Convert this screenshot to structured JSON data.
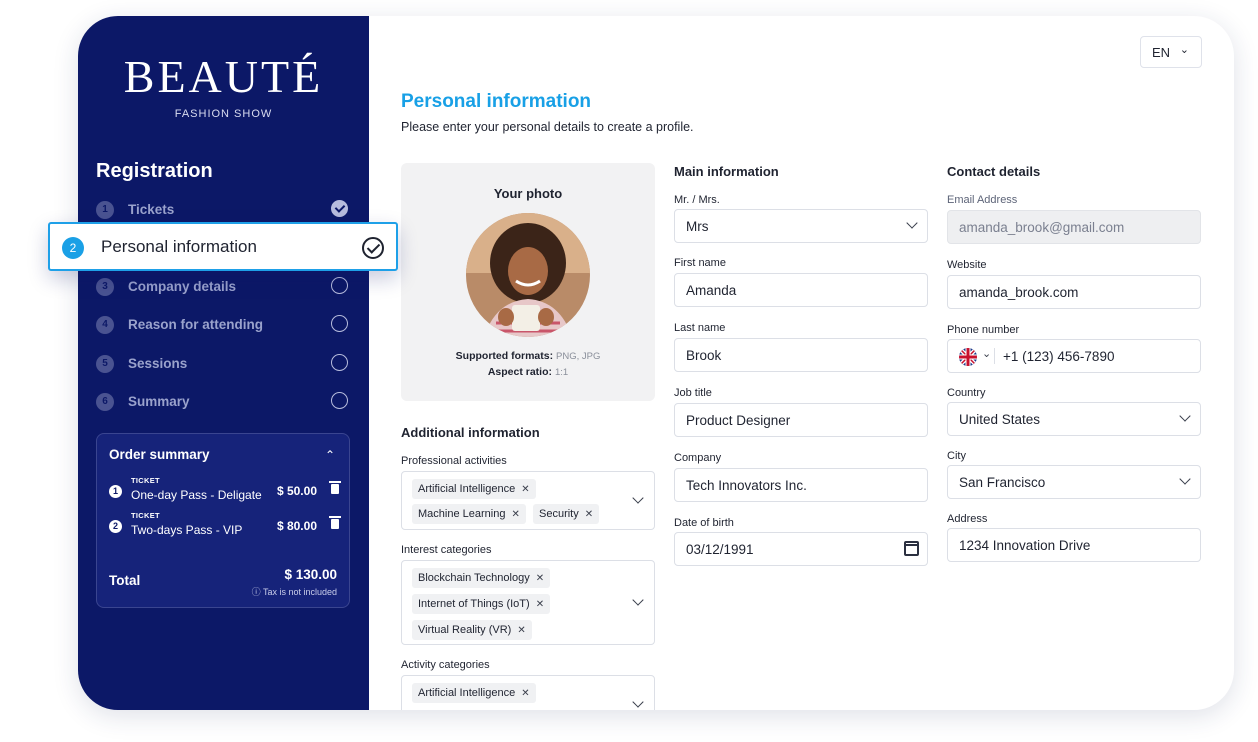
{
  "brand": {
    "name": "BEAUTÉ",
    "subtitle": "FASHION SHOW"
  },
  "sidebar": {
    "title": "Registration",
    "steps": [
      {
        "num": "1",
        "label": "Tickets",
        "status": "done"
      },
      {
        "num": "2",
        "label": "Personal information",
        "status": "active"
      },
      {
        "num": "3",
        "label": "Company details",
        "status": "todo"
      },
      {
        "num": "4",
        "label": "Reason for attending",
        "status": "todo"
      },
      {
        "num": "5",
        "label": "Sessions",
        "status": "todo"
      },
      {
        "num": "6",
        "label": "Summary",
        "status": "todo"
      }
    ]
  },
  "order": {
    "title": "Order summary",
    "items": [
      {
        "num": "1",
        "tag": "TICKET",
        "name": "One-day Pass - Deligate",
        "price": "$ 50.00"
      },
      {
        "num": "2",
        "tag": "TICKET",
        "name": "Two-days Pass - VIP",
        "price": "$ 80.00"
      }
    ],
    "total_label": "Total",
    "total_value": "$ 130.00",
    "tax_note": "ⓘ Tax is not included"
  },
  "lang": {
    "value": "EN"
  },
  "page": {
    "title": "Personal information",
    "subtitle": "Please enter your personal details to create a profile."
  },
  "photo": {
    "title": "Your photo",
    "formats_label": "Supported formats:",
    "formats_value": "PNG, JPG",
    "ratio_label": "Aspect ratio:",
    "ratio_value": "1:1"
  },
  "additional": {
    "title": "Additional information",
    "professional_label": "Professional activities",
    "professional": [
      "Artificial Intelligence",
      "Machine Learning",
      "Security"
    ],
    "interest_label": "Interest categories",
    "interest": [
      "Blockchain Technology",
      "Internet of Things (IoT)",
      "Virtual Reality (VR)"
    ],
    "activity_label": "Activity categories",
    "activity": [
      "Artificial Intelligence"
    ]
  },
  "main": {
    "title": "Main information",
    "salutation_label": "Mr. / Mrs.",
    "salutation": "Mrs",
    "first_label": "First name",
    "first": "Amanda",
    "last_label": "Last name",
    "last": "Brook",
    "job_label": "Job title",
    "job": "Product Designer",
    "company_label": "Company",
    "company": "Tech Innovators Inc.",
    "dob_label": "Date of birth",
    "dob": "03/12/1991"
  },
  "contact": {
    "title": "Contact details",
    "email_label": "Email Address",
    "email": "amanda_brook@gmail.com",
    "website_label": "Website",
    "website": "amanda_brook.com",
    "phone_label": "Phone number",
    "phone": "+1 (123) 456-7890",
    "country_label": "Country",
    "country": "United States",
    "city_label": "City",
    "city": "San Francisco",
    "address_label": "Address",
    "address": "1234 Innovation Drive"
  },
  "colors": {
    "sidebar": "#0c1867",
    "accent": "#18a0e6"
  },
  "icons": {
    "check": "check-circle-icon",
    "chevron": "chevron-down-icon",
    "trash": "trash-icon",
    "calendar": "calendar-icon",
    "flag": "uk-flag-icon"
  }
}
